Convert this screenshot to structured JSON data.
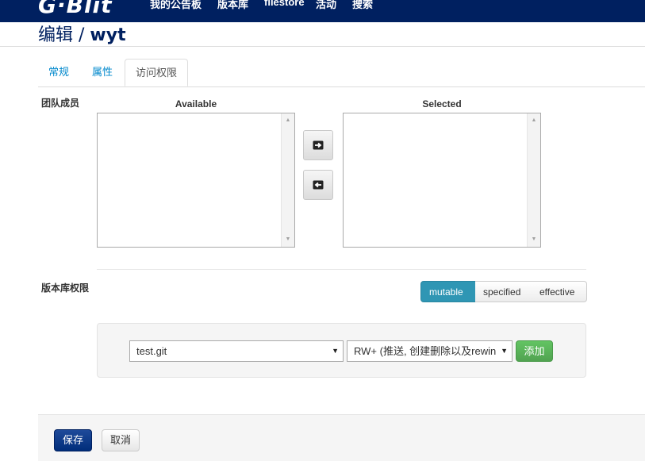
{
  "navbar": {
    "logo": "G·Blit",
    "links": [
      "我的公告板",
      "版本库",
      "filestore",
      "活动",
      "搜索"
    ]
  },
  "page": {
    "title_prefix": "编辑 / ",
    "title_name": "wyt"
  },
  "tabs": [
    "常规",
    "属性",
    "访问权限"
  ],
  "team_members": {
    "label": "团队成员",
    "available_header": "Available",
    "selected_header": "Selected",
    "available_items": [],
    "selected_items": []
  },
  "repo_permissions": {
    "label": "版本库权限",
    "modes": [
      "mutable",
      "specified",
      "effective"
    ],
    "active_mode": "mutable",
    "repository_select_value": "test.git",
    "permission_select_value": "RW+ (推送, 创建删除以及rewin",
    "add_label": "添加"
  },
  "footer": {
    "save_label": "保存",
    "cancel_label": "取消"
  },
  "colors": {
    "navbar": "#002060",
    "primary": "#002d7a",
    "mode_active": "#2f96b4",
    "add_button": "#51a351"
  }
}
